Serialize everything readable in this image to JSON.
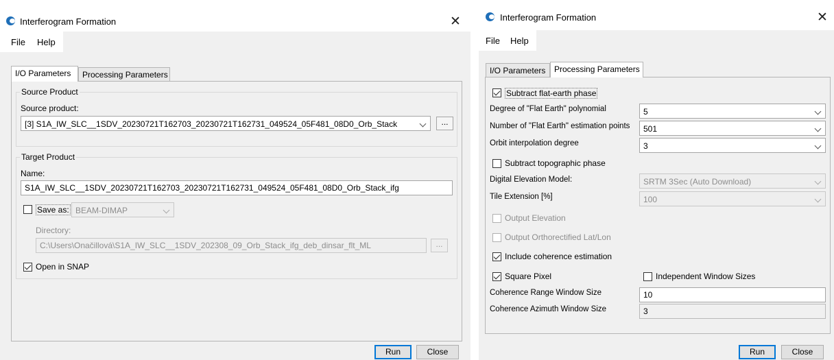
{
  "left": {
    "title": "Interferogram Formation",
    "close_glyph": "✕",
    "menu": {
      "file": "File",
      "help": "Help"
    },
    "tabs": {
      "io": "I/O Parameters",
      "processing": "Processing Parameters"
    },
    "source_group": {
      "title": "Source Product",
      "label": "Source product:",
      "selected": "[3] S1A_IW_SLC__1SDV_20230721T162703_20230721T162731_049524_05F481_08D0_Orb_Stack",
      "browse": "..."
    },
    "target_group": {
      "title": "Target Product",
      "name_label": "Name:",
      "name_value": "S1A_IW_SLC__1SDV_20230721T162703_20230721T162731_049524_05F481_08D0_Orb_Stack_ifg",
      "save_as_label": "Save as:",
      "save_as_checked": false,
      "format": "BEAM-DIMAP",
      "directory_label": "Directory:",
      "directory_value": "C:\\Users\\Onačillová\\S1A_IW_SLC__1SDV_202308_09_Orb_Stack_ifg_deb_dinsar_flt_ML",
      "browse": "...",
      "open_in_snap_label": "Open in SNAP",
      "open_in_snap_checked": true
    },
    "buttons": {
      "run": "Run",
      "close": "Close"
    }
  },
  "right": {
    "title": "Interferogram Formation",
    "close_glyph": "✕",
    "menu": {
      "file": "File",
      "help": "Help"
    },
    "tabs": {
      "io": "I/O Parameters",
      "processing": "Processing Parameters"
    },
    "params": {
      "subtract_flat_earth": {
        "label": "Subtract flat-earth phase",
        "checked": true
      },
      "degree_flat_earth": {
        "label": "Degree of \"Flat Earth\" polynomial",
        "value": "5"
      },
      "num_estimation_points": {
        "label": "Number of \"Flat Earth\" estimation points",
        "value": "501"
      },
      "orbit_interp_degree": {
        "label": "Orbit interpolation degree",
        "value": "3"
      },
      "subtract_topo": {
        "label": "Subtract topographic phase",
        "checked": false
      },
      "dem": {
        "label": "Digital Elevation Model:",
        "value": "SRTM 3Sec (Auto Download)"
      },
      "tile_extension": {
        "label": "Tile Extension [%]",
        "value": "100"
      },
      "output_elevation": {
        "label": "Output Elevation",
        "checked": false
      },
      "output_ortho": {
        "label": "Output Orthorectified Lat/Lon",
        "checked": false
      },
      "include_coherence": {
        "label": "Include coherence estimation",
        "checked": true
      },
      "square_pixel": {
        "label": "Square Pixel",
        "checked": true
      },
      "independent_windows": {
        "label": "Independent Window Sizes",
        "checked": false
      },
      "coh_range": {
        "label": "Coherence Range Window Size",
        "value": "10"
      },
      "coh_azimuth": {
        "label": "Coherence Azimuth Window Size",
        "value": "3"
      }
    },
    "buttons": {
      "run": "Run",
      "close": "Close"
    }
  },
  "colors": {
    "window_bg": "#f0f0f0",
    "accent": "#0078d7",
    "icon_blue": "#1f6fb8"
  }
}
